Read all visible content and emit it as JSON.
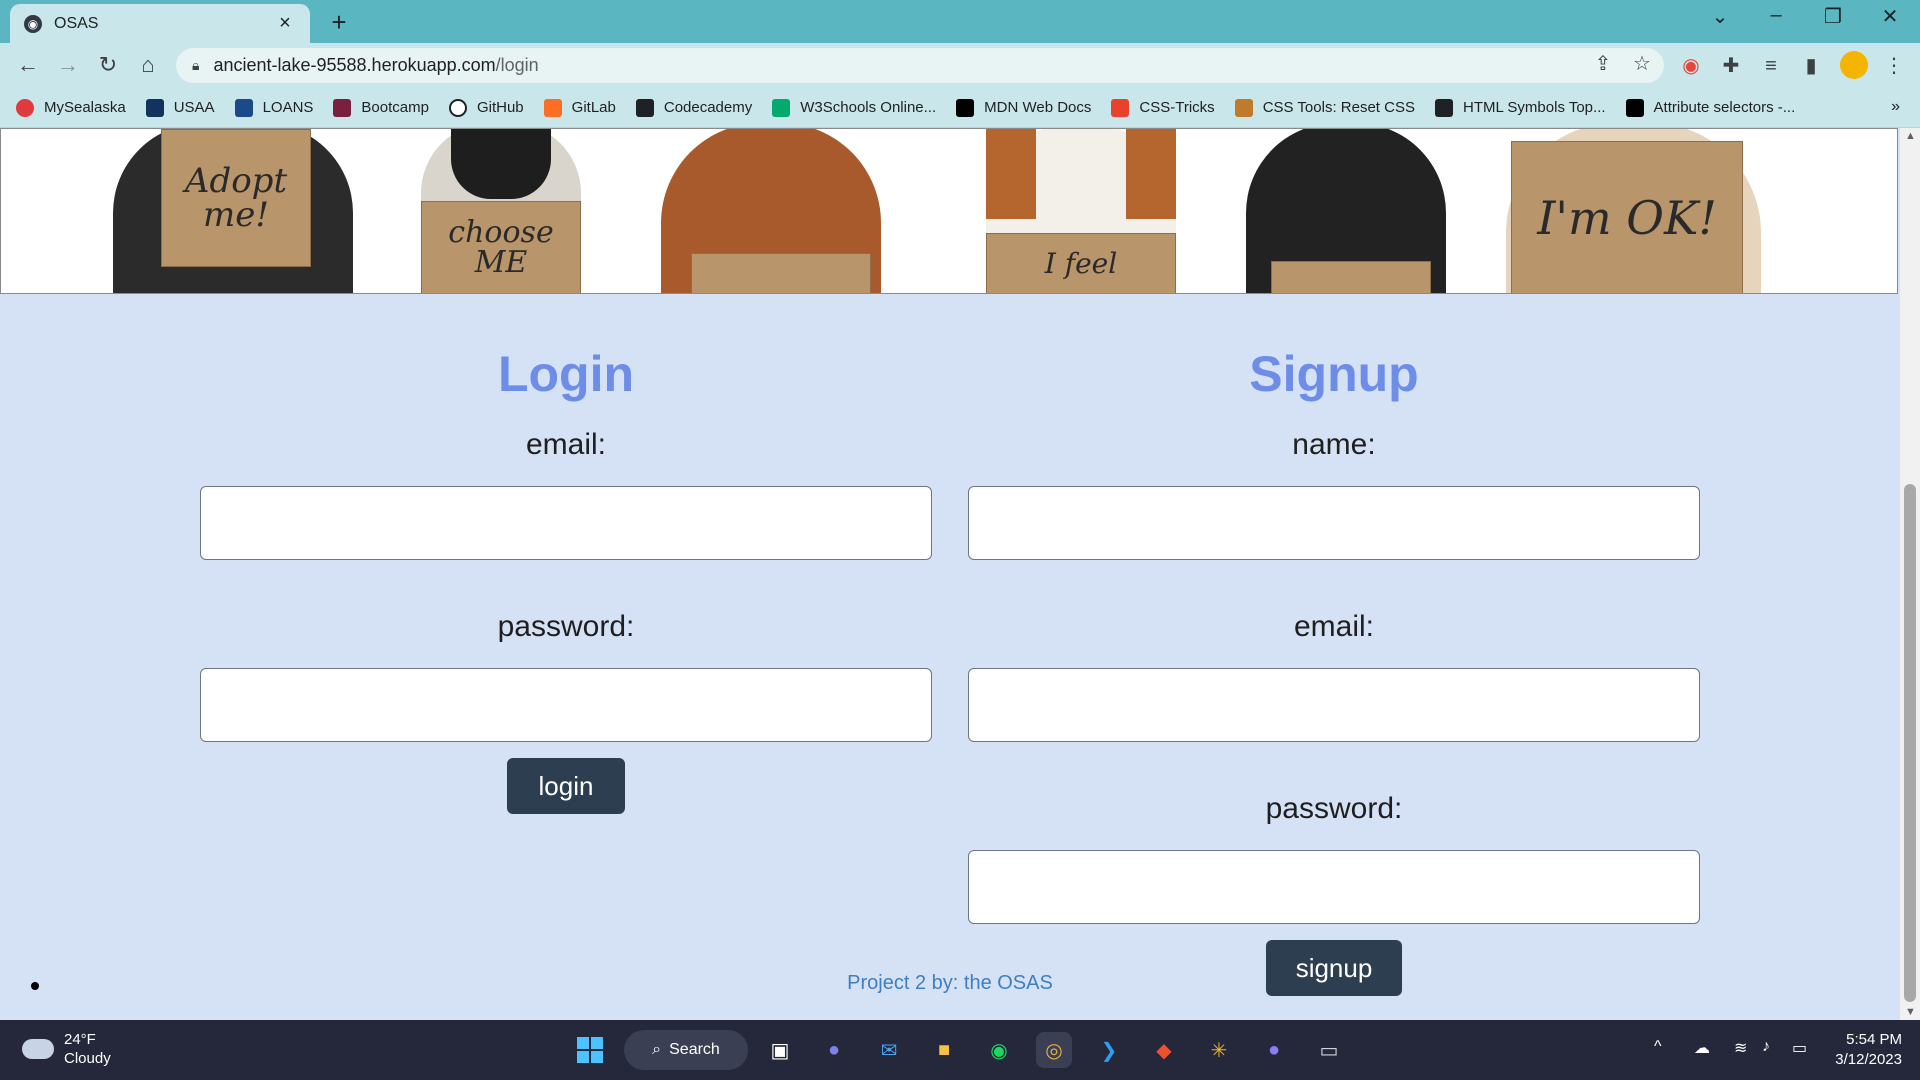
{
  "browser": {
    "tab_title": "OSAS",
    "tab_close": "×",
    "new_tab": "+",
    "url_host": "ancient-lake-95588.herokuapp.com",
    "url_path": "/login",
    "bookmarks": [
      {
        "label": "MySealaska",
        "icon": "mysealaska-icon",
        "color": "#e03a3e"
      },
      {
        "label": "USAA",
        "icon": "usaa-icon",
        "color": "#12335e"
      },
      {
        "label": "LOANS",
        "icon": "loans-icon",
        "color": "#1a4a8a"
      },
      {
        "label": "Bootcamp",
        "icon": "bootcamp-icon",
        "color": "#7a1f3d"
      },
      {
        "label": "GitHub",
        "icon": "github-icon",
        "color": "#ffffff"
      },
      {
        "label": "GitLab",
        "icon": "gitlab-icon",
        "color": "#fc6d26"
      },
      {
        "label": "Codecademy",
        "icon": "codecademy-icon",
        "color": "#202124"
      },
      {
        "label": "W3Schools Online...",
        "icon": "w3schools-icon",
        "color": "#04aa6d"
      },
      {
        "label": "MDN Web Docs",
        "icon": "mdn-icon",
        "color": "#000000"
      },
      {
        "label": "CSS-Tricks",
        "icon": "css-tricks-icon",
        "color": "#e8412c"
      },
      {
        "label": "CSS Tools: Reset CSS",
        "icon": "reset-css-icon",
        "color": "#c07a2c"
      },
      {
        "label": "HTML Symbols Top...",
        "icon": "html-symbols-icon",
        "color": "#202124"
      },
      {
        "label": "Attribute selectors -...",
        "icon": "mdn-icon",
        "color": "#000000"
      }
    ],
    "bookmarks_more": "»"
  },
  "banner": {
    "signs": [
      "Adopt me!",
      "choose ME",
      "",
      "I feel",
      "",
      "I'm OK!"
    ]
  },
  "login": {
    "heading": "Login",
    "email_label": "email:",
    "password_label": "password:",
    "button": "login"
  },
  "signup": {
    "heading": "Signup",
    "name_label": "name:",
    "email_label": "email:",
    "password_label": "password:",
    "button": "signup"
  },
  "footer": {
    "text": "Project 2 by: the OSAS"
  },
  "taskbar": {
    "temperature": "24°F",
    "condition": "Cloudy",
    "search_label": "Search",
    "time": "5:54 PM",
    "date": "3/12/2023"
  },
  "colors": {
    "heading": "#6e8de8",
    "page_bg": "#d5e1f5",
    "button_bg": "#2c3e50",
    "footer_link": "#3f7fbf",
    "tabbar": "#5ab7c2"
  }
}
